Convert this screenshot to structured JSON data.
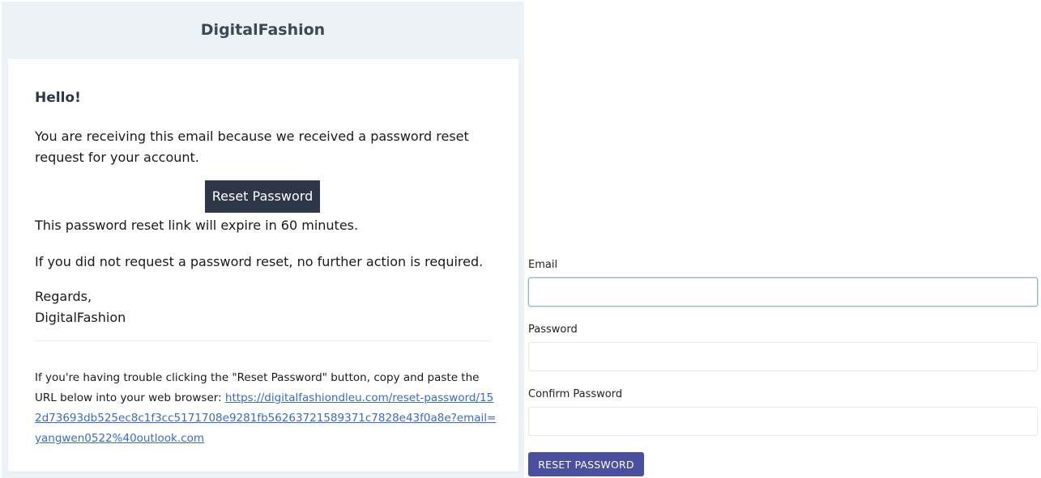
{
  "email": {
    "brand": "DigitalFashion",
    "greeting": "Hello!",
    "intro": "You are receiving this email because we received a password reset request for your account.",
    "button_label": "Reset Password",
    "expire_note": "This password reset link will expire in 60 minutes.",
    "no_action_note": "If you did not request a password reset, no further action is required.",
    "regards": "Regards,",
    "signature": "DigitalFashion",
    "subcopy_text": "If you're having trouble clicking the \"Reset Password\" button, copy and paste the URL below into your web browser: ",
    "reset_url": "https://digitalfashiondleu.com/reset-password/152d73693db525ec8c1f3cc5171708e9281fb56263721589371c7828e43f0a8e?email=yangwen0522%40outlook.com"
  },
  "form": {
    "email_label": "Email",
    "email_value": "",
    "password_label": "Password",
    "password_value": "",
    "confirm_label": "Confirm Password",
    "confirm_value": "",
    "submit_label": "RESET PASSWORD"
  },
  "colors": {
    "email_background": "#edf2f7",
    "button_dark": "#2d3748",
    "link": "#3869d4",
    "submit_button": "#4a4fa0",
    "focus_border": "#8fbcae"
  }
}
